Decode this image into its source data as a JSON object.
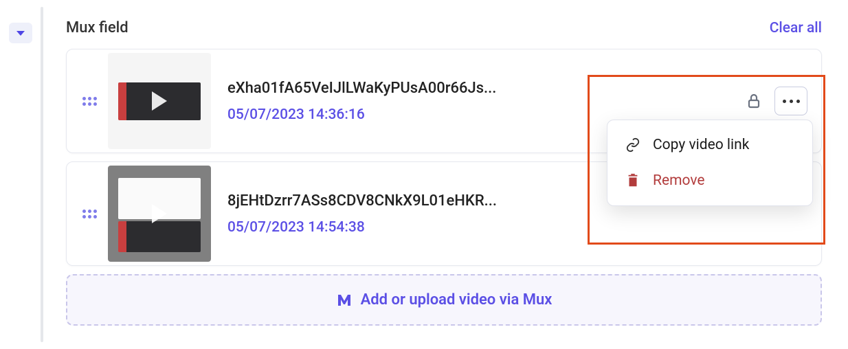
{
  "field": {
    "title": "Mux field",
    "clear_all": "Clear all"
  },
  "videos": [
    {
      "id": "eXha01fA65VeIJlLWaKyPUsA00r66Js...",
      "timestamp": "05/07/2023 14:36:16"
    },
    {
      "id": "8jEHtDzrr7ASs8CDV8CNkX9L01eHKR...",
      "timestamp": "05/07/2023 14:54:38"
    }
  ],
  "popover": {
    "copy": "Copy video link",
    "remove": "Remove"
  },
  "upload": {
    "label": "Add or upload video via Mux"
  }
}
